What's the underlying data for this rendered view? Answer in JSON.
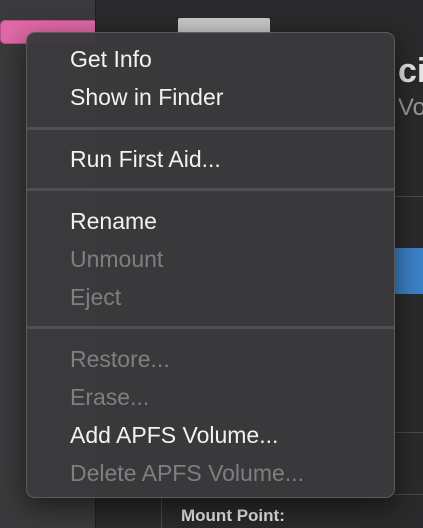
{
  "background": {
    "big_letter": "ci",
    "sub_text": "Vo",
    "mount_point_label": "Mount Point:"
  },
  "context_menu": {
    "items": [
      {
        "label": "Get Info",
        "enabled": true
      },
      {
        "label": "Show in Finder",
        "enabled": true
      },
      {
        "label": "Run First Aid...",
        "enabled": true
      },
      {
        "label": "Rename",
        "enabled": true
      },
      {
        "label": "Unmount",
        "enabled": false
      },
      {
        "label": "Eject",
        "enabled": false
      },
      {
        "label": "Restore...",
        "enabled": false
      },
      {
        "label": "Erase...",
        "enabled": false
      },
      {
        "label": "Add APFS Volume...",
        "enabled": true
      },
      {
        "label": "Delete APFS Volume...",
        "enabled": false
      }
    ]
  },
  "colors": {
    "menu_background": "#3a3a3c",
    "enabled_text": "#f2f2f2",
    "disabled_text": "#7f7f81",
    "sidebar_selection": "#e06aa8",
    "accent_blue": "#3b82c8"
  }
}
